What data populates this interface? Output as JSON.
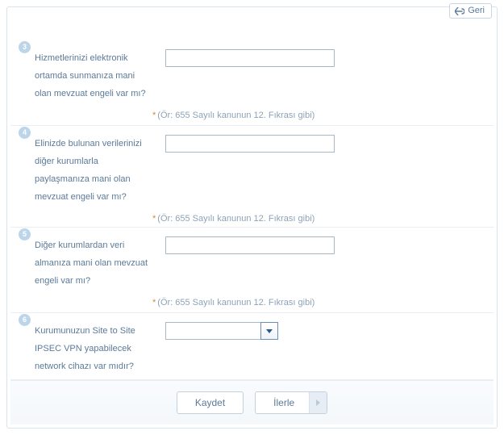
{
  "back_label": "Geri",
  "questions": {
    "q3": {
      "num": "3",
      "label": "Hizmetlerinizi elektronik ortamda sunmanıza mani olan mevzuat engeli var mı?",
      "value": "",
      "hint": "(Ör: 655 Sayılı kanunun 12. Fıkrası gibi)"
    },
    "q4": {
      "num": "4",
      "label": "Elinizde bulunan verilerinizi diğer kurumlarla paylaşmanıza mani olan mevzuat engeli var mı?",
      "value": "",
      "hint": "(Ör: 655 Sayılı kanunun 12. Fıkrası gibi)"
    },
    "q5": {
      "num": "5",
      "label": "Diğer kurumlardan veri almanıza mani olan mevzuat engeli var mı?",
      "value": "",
      "hint": "(Ör: 655 Sayılı kanunun 12. Fıkrası gibi)"
    },
    "q6": {
      "num": "6",
      "label": "Kurumunuzun Site to Site IPSEC VPN yapabilecek network cihazı var mıdır?",
      "selected": ""
    }
  },
  "buttons": {
    "save": "Kaydet",
    "next": "İlerle"
  }
}
